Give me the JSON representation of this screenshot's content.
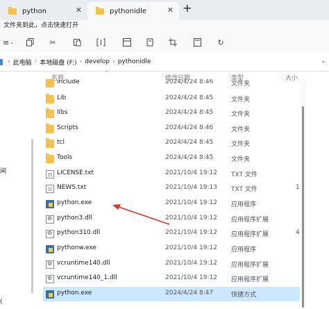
{
  "tabs": [
    {
      "label": "python"
    },
    {
      "label": "pythonidle"
    }
  ],
  "new_tab": "+",
  "ribbon": {
    "hint": "文件夹到此，点击快速打开",
    "buttons": [
      {
        "name": "new",
        "icon": "menu-icon",
        "glyph": "≡"
      },
      {
        "name": "copy",
        "icon": "copy-icon"
      },
      {
        "name": "cut",
        "icon": "cut-icon",
        "glyph": "✂"
      },
      {
        "name": "paste",
        "icon": "paste-icon"
      },
      {
        "name": "rename",
        "icon": "rename-icon"
      },
      {
        "name": "share",
        "icon": "share-icon"
      },
      {
        "name": "delete",
        "icon": "delete-icon"
      },
      {
        "name": "crop",
        "icon": "crop-icon"
      },
      {
        "name": "properties",
        "icon": "properties-icon"
      },
      {
        "name": "refresh",
        "icon": "refresh-icon",
        "glyph": "↻"
      }
    ]
  },
  "breadcrumb": [
    "此电脑",
    "本地磁盘 (F:)",
    "develop",
    "pythonidle"
  ],
  "headers": {
    "name": "名称",
    "date": "修改日期",
    "type": "类型",
    "size": "大小"
  },
  "nav": {
    "frag1": "间",
    "frag2": "("
  },
  "rows": [
    {
      "name": "include",
      "date": "2024/4/24 8:46",
      "type": "文件夹",
      "size": "",
      "icon": "folder"
    },
    {
      "name": "Lib",
      "date": "2024/4/24 8:45",
      "type": "文件夹",
      "size": "",
      "icon": "folder"
    },
    {
      "name": "libs",
      "date": "2024/4/24 8:45",
      "type": "文件夹",
      "size": "",
      "icon": "folder"
    },
    {
      "name": "Scripts",
      "date": "2024/4/24 8:46",
      "type": "文件夹",
      "size": "",
      "icon": "folder"
    },
    {
      "name": "tcl",
      "date": "2024/4/24 8:45",
      "type": "文件夹",
      "size": "",
      "icon": "folder"
    },
    {
      "name": "Tools",
      "date": "2024/4/24 8:45",
      "type": "文件夹",
      "size": "",
      "icon": "folder"
    },
    {
      "name": "LICENSE.txt",
      "date": "2021/10/4 19:12",
      "type": "TXT 文件",
      "size": "",
      "icon": "doc"
    },
    {
      "name": "NEWS.txt",
      "date": "2021/10/4 19:13",
      "type": "TXT 文件",
      "size": "1,",
      "icon": "doc"
    },
    {
      "name": "python.exe",
      "date": "2021/10/4 19:12",
      "type": "应用程序",
      "size": "",
      "icon": "pyico"
    },
    {
      "name": "python3.dll",
      "date": "2021/10/4 19:12",
      "type": "应用程序扩展",
      "size": "",
      "icon": "gear"
    },
    {
      "name": "python310.dll",
      "date": "2021/10/4 19:12",
      "type": "应用程序扩展",
      "size": "4,",
      "icon": "gear"
    },
    {
      "name": "pythonw.exe",
      "date": "2021/10/4 19:12",
      "type": "应用程序",
      "size": "",
      "icon": "pyico"
    },
    {
      "name": "vcruntime140.dll",
      "date": "2021/10/4 19:12",
      "type": "应用程序扩展",
      "size": "",
      "icon": "gear"
    },
    {
      "name": "vcruntime140_1.dll",
      "date": "2021/10/4 19:12",
      "type": "应用程序扩展",
      "size": "",
      "icon": "gear"
    },
    {
      "name": "python.exe",
      "date": "2024/4/24 8:47",
      "type": "快捷方式",
      "size": "",
      "icon": "pyico",
      "selected": true
    }
  ],
  "colors": {
    "selection": "#cce8ff",
    "folder": "#f2c14e",
    "arrow": "#d9342b"
  }
}
